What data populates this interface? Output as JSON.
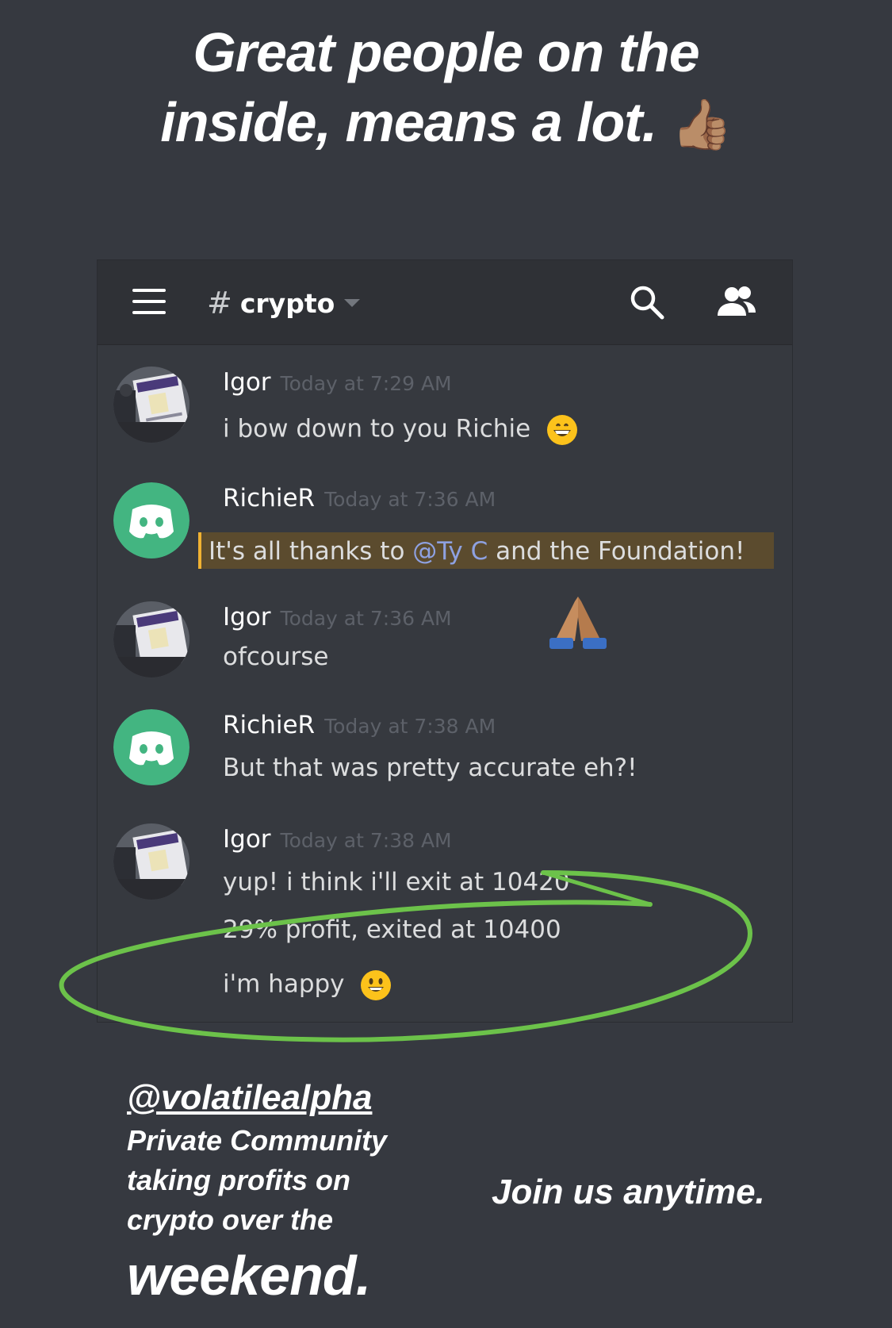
{
  "story": {
    "caption_line1": "Great people on the",
    "caption_line2": "inside, means a lot.",
    "caption_emoji": "👍🏽"
  },
  "discord": {
    "channel": {
      "hash": "#",
      "name": "crypto"
    },
    "icons": {
      "menu": "hamburger-icon",
      "search": "search-icon",
      "members": "members-icon",
      "channel_dropdown": "chevron-down-icon"
    },
    "colors": {
      "mention_bg": "#5b4b2e",
      "mention_border": "#f0b232",
      "mention_text": "#8ea1e1",
      "annotation": "#6cc24a"
    },
    "messages": [
      {
        "user": "Igor",
        "time": "Today at 7:29 AM",
        "lines": [
          "i bow down to you Richie"
        ],
        "emoji": "😄"
      },
      {
        "user": "RichieR",
        "time": "Today at 7:36 AM",
        "mention_pre": "It's all thanks to ",
        "mention": "@Ty C",
        "mention_post": " and the Foundation!"
      },
      {
        "user": "Igor",
        "time": "Today at 7:36 AM",
        "lines": [
          "ofcourse"
        ],
        "reaction_emoji": "🙏🏽"
      },
      {
        "user": "RichieR",
        "time": "Today at 7:38 AM",
        "lines": [
          "But that was pretty accurate eh?!"
        ]
      },
      {
        "user": "Igor",
        "time": "Today at 7:38 AM",
        "lines": [
          "yup! i think i'll exit at 10420",
          "29% profit, exited at 10400",
          "i'm happy"
        ],
        "emoji": "😃"
      }
    ]
  },
  "bottom": {
    "handle": "@volatilealpha",
    "blurb_line1": "Private Community",
    "blurb_line2": "taking profits on",
    "blurb_line3": "crypto over the",
    "blurb_big": "weekend.",
    "join": "Join us anytime."
  }
}
